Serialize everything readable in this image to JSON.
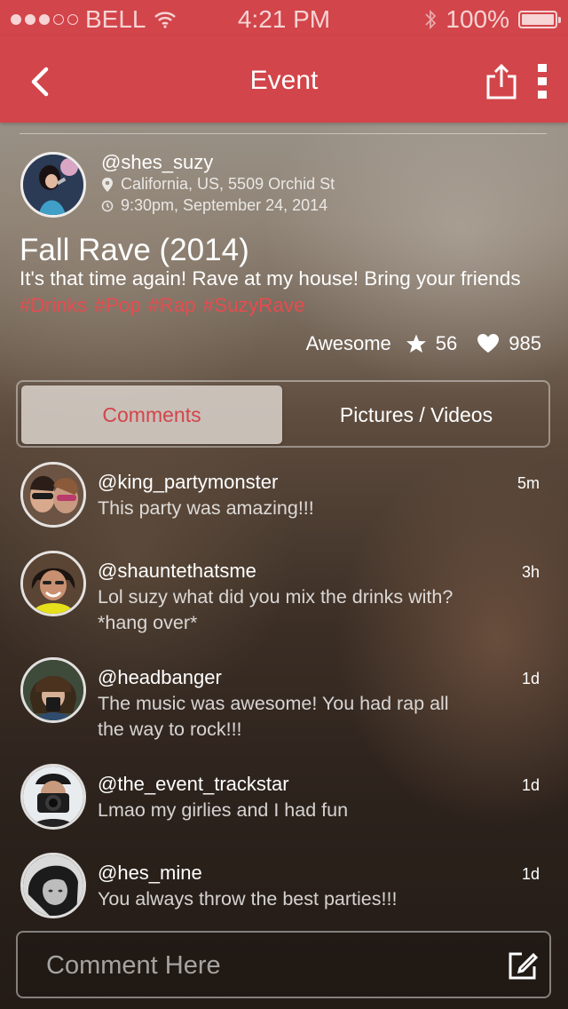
{
  "status_bar": {
    "carrier": "BELL",
    "time": "4:21 PM",
    "battery": "100%",
    "battery_level": 1.0,
    "signal_bars": 3,
    "signal_total": 5
  },
  "nav": {
    "title": "Event",
    "icons": [
      "chevron-left-icon",
      "share-icon",
      "more-vertical-icon"
    ]
  },
  "host": {
    "handle": "@shes_suzy",
    "location": "California, US, 5509 Orchid St",
    "datetime": "9:30pm, September 24, 2014"
  },
  "event": {
    "title": "Fall Rave (2014)",
    "description": "It's that time again! Rave at my house! Bring your friends",
    "tags": [
      "#Drinks",
      "#Pop",
      "#Rap",
      "#SuzyRave"
    ],
    "rating_label": "Awesome",
    "stars": "56",
    "likes": "985"
  },
  "tabs": {
    "comments": "Comments",
    "media": "Pictures / Videos",
    "active": "comments"
  },
  "comments": [
    {
      "handle": "@king_partymonster",
      "text": "This party was amazing!!!",
      "age": "5m"
    },
    {
      "handle": "@shauntethatsme",
      "text": "Lol suzy what did you mix the drinks with? *hang over*",
      "age": "3h"
    },
    {
      "handle": "@headbanger",
      "text": "The music was awesome! You had rap all the way to rock!!!",
      "age": "1d"
    },
    {
      "handle": "@the_event_trackstar",
      "text": "Lmao my girlies and I had fun",
      "age": "1d"
    },
    {
      "handle": "@hes_mine",
      "text": "You always throw the best parties!!!",
      "age": "1d"
    }
  ],
  "comment_input": {
    "placeholder": "Comment Here",
    "value": ""
  },
  "colors": {
    "brand": "#d2454a",
    "tag": "#e74c4f"
  }
}
